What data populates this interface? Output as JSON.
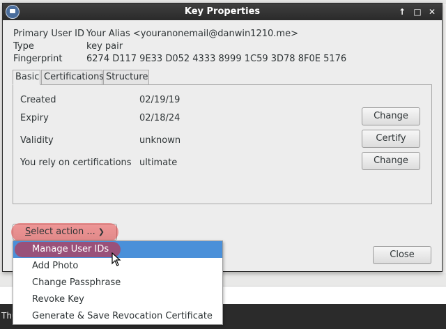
{
  "window": {
    "title": "Key Properties"
  },
  "info": {
    "primary_user_id_label": "Primary User ID",
    "primary_user_id_value": "Your Alias <youranonemail@danwin1210.me>",
    "type_label": "Type",
    "type_value": "key pair",
    "fingerprint_label": "Fingerprint",
    "fingerprint_value": "6274 D117 9E33 D052 4333 8999 1C59 3D78 8F0E 5176"
  },
  "tabs": [
    "Basic",
    "Certifications",
    "Structure"
  ],
  "basic": {
    "created_label": "Created",
    "created_value": "02/19/19",
    "expiry_label": "Expiry",
    "expiry_value": "02/18/24",
    "expiry_button": "Change",
    "validity_label": "Validity",
    "validity_value": "unknown",
    "validity_button": "Certify",
    "rely_label": "You rely on certifications",
    "rely_value": "ultimate",
    "rely_button": "Change"
  },
  "select_action": {
    "label": "Select action ...",
    "mnemonic": "S"
  },
  "close_button": "Close",
  "menu": {
    "items": [
      "Manage User IDs",
      "Add Photo",
      "Change Passphrase",
      "Revoke Key",
      "Generate & Save Revocation Certificate"
    ],
    "selected_index": 0
  },
  "taskbar": {
    "text": "Thu"
  },
  "colors": {
    "selection": "#4a90d9",
    "highlight_marker": "#e64646",
    "titlebar": "#2f2f2f"
  }
}
